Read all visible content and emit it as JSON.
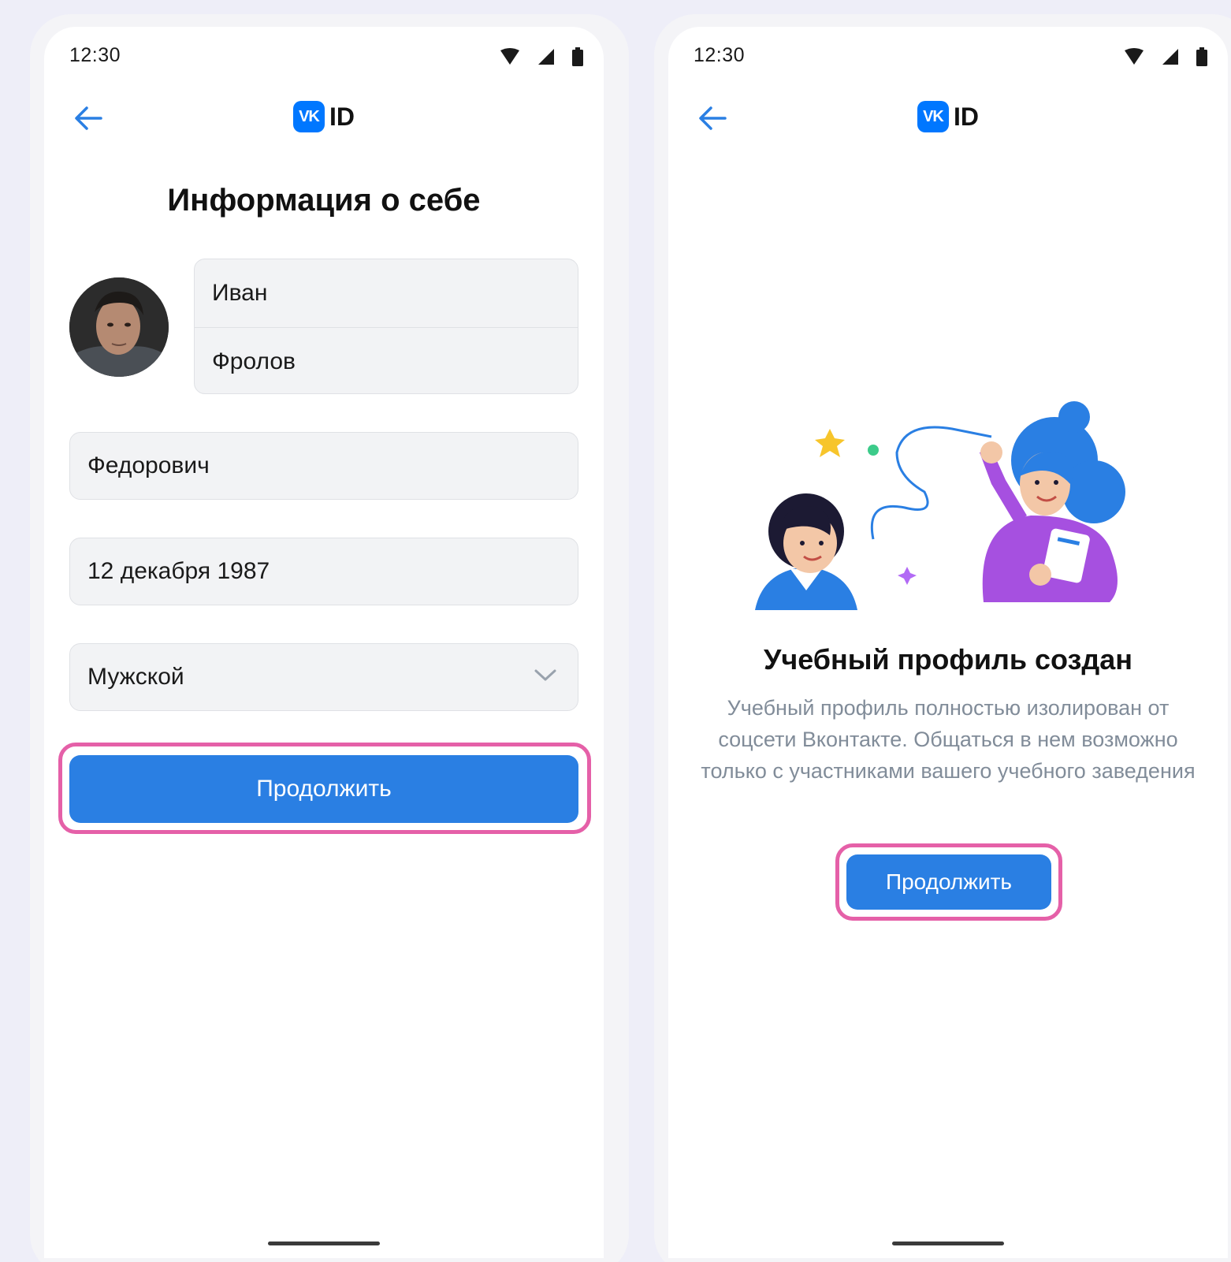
{
  "left_screen": {
    "status": {
      "time": "12:30"
    },
    "logo": {
      "badge": "VK",
      "text": "ID"
    },
    "title": "Информация о себе",
    "first_name": "Иван",
    "last_name": "Фролов",
    "patronymic": "Федорович",
    "birth_date": "12 декабря 1987",
    "gender": "Мужской",
    "continue_label": "Продолжить"
  },
  "right_screen": {
    "status": {
      "time": "12:30"
    },
    "logo": {
      "badge": "VK",
      "text": "ID"
    },
    "title": "Учебный профиль создан",
    "description": "Учебный профиль полностью изолирован от соцсети Вконтакте. Общаться в нем возможно только с участниками вашего учебного заведения",
    "continue_label": "Продолжить"
  },
  "colors": {
    "accent": "#2a7fe3",
    "logo": "#0077ff",
    "highlight": "#e560a8",
    "field_bg": "#f2f3f5",
    "secondary_text": "#818c99"
  },
  "icons": {
    "back": "arrow-left-icon",
    "wifi": "wifi-icon",
    "signal": "signal-icon",
    "battery": "battery-icon",
    "chevron": "chevron-down-icon"
  }
}
